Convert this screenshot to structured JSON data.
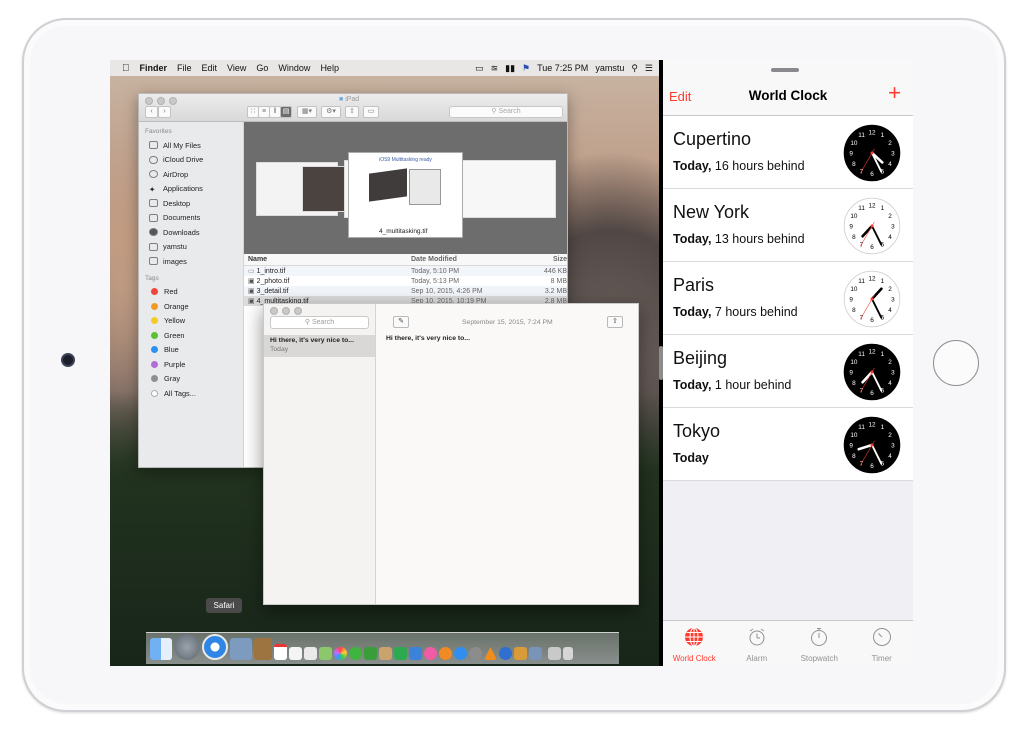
{
  "mac": {
    "menubar": {
      "apple": "",
      "items": [
        "Finder",
        "File",
        "Edit",
        "View",
        "Go",
        "Window",
        "Help"
      ],
      "clock": "Tue 7:25 PM",
      "user": "yamstu"
    },
    "finder": {
      "title": "iPad",
      "search_placeholder": "Search",
      "favorites_header": "Favorites",
      "favorites": [
        "All My Files",
        "iCloud Drive",
        "AirDrop",
        "Applications",
        "Desktop",
        "Documents",
        "Downloads",
        "yamstu",
        "images"
      ],
      "tags_header": "Tags",
      "tags": [
        {
          "label": "Red",
          "color": "#f0453a"
        },
        {
          "label": "Orange",
          "color": "#f39a24"
        },
        {
          "label": "Yellow",
          "color": "#f5cb23"
        },
        {
          "label": "Green",
          "color": "#5ac137"
        },
        {
          "label": "Blue",
          "color": "#2e90f3"
        },
        {
          "label": "Purple",
          "color": "#b36bd8"
        },
        {
          "label": "Gray",
          "color": "#8e8e93"
        },
        {
          "label": "All Tags...",
          "color": "#d0d0d0"
        }
      ],
      "preview_slide_title": "iOS9 Multitasking ready",
      "preview_caption": "4_multitasking.tif",
      "columns": {
        "name": "Name",
        "date": "Date Modified",
        "size": "Size"
      },
      "files": [
        {
          "name": "1_intro.tif",
          "date": "Today, 5:10 PM",
          "size": "446 KB"
        },
        {
          "name": "2_photo.tif",
          "date": "Today, 5:13 PM",
          "size": "8 MB"
        },
        {
          "name": "3_detail.tif",
          "date": "Sep 10, 2015, 4:26 PM",
          "size": "3.2 MB"
        },
        {
          "name": "4_multitasking.tif",
          "date": "Sep 10, 2015, 10:19 PM",
          "size": "2.8 MB"
        }
      ]
    },
    "notes": {
      "search_placeholder": "Search",
      "date": "September 15, 2015, 7:24 PM",
      "note_title": "Hi there,  it's very nice to...",
      "note_subtitle": "Today",
      "note_body": "Hi there,  it's very nice to..."
    },
    "dock": {
      "tooltip": "Safari"
    }
  },
  "ios": {
    "nav": {
      "edit": "Edit",
      "title": "World Clock",
      "add": "+"
    },
    "clocks": [
      {
        "city": "Cupertino",
        "day": "Today,",
        "offset": "16 hours behind",
        "hour": 4,
        "minute": 25,
        "second": 35,
        "dark": true
      },
      {
        "city": "New York",
        "day": "Today,",
        "offset": "13 hours behind",
        "hour": 7,
        "minute": 25,
        "second": 35,
        "dark": false
      },
      {
        "city": "Paris",
        "day": "Today,",
        "offset": "7 hours behind",
        "hour": 1,
        "minute": 25,
        "second": 35,
        "dark": false
      },
      {
        "city": "Beijing",
        "day": "Today,",
        "offset": "1 hour behind",
        "hour": 7,
        "minute": 25,
        "second": 35,
        "dark": true
      },
      {
        "city": "Tokyo",
        "day": "Today",
        "offset": "",
        "hour": 8,
        "minute": 25,
        "second": 35,
        "dark": true
      }
    ],
    "tabs": [
      {
        "label": "World Clock",
        "active": true,
        "icon": "globe-icon"
      },
      {
        "label": "Alarm",
        "active": false,
        "icon": "alarm-clock-icon"
      },
      {
        "label": "Stopwatch",
        "active": false,
        "icon": "stopwatch-icon"
      },
      {
        "label": "Timer",
        "active": false,
        "icon": "timer-icon"
      }
    ],
    "accent": "#ff3b30"
  }
}
